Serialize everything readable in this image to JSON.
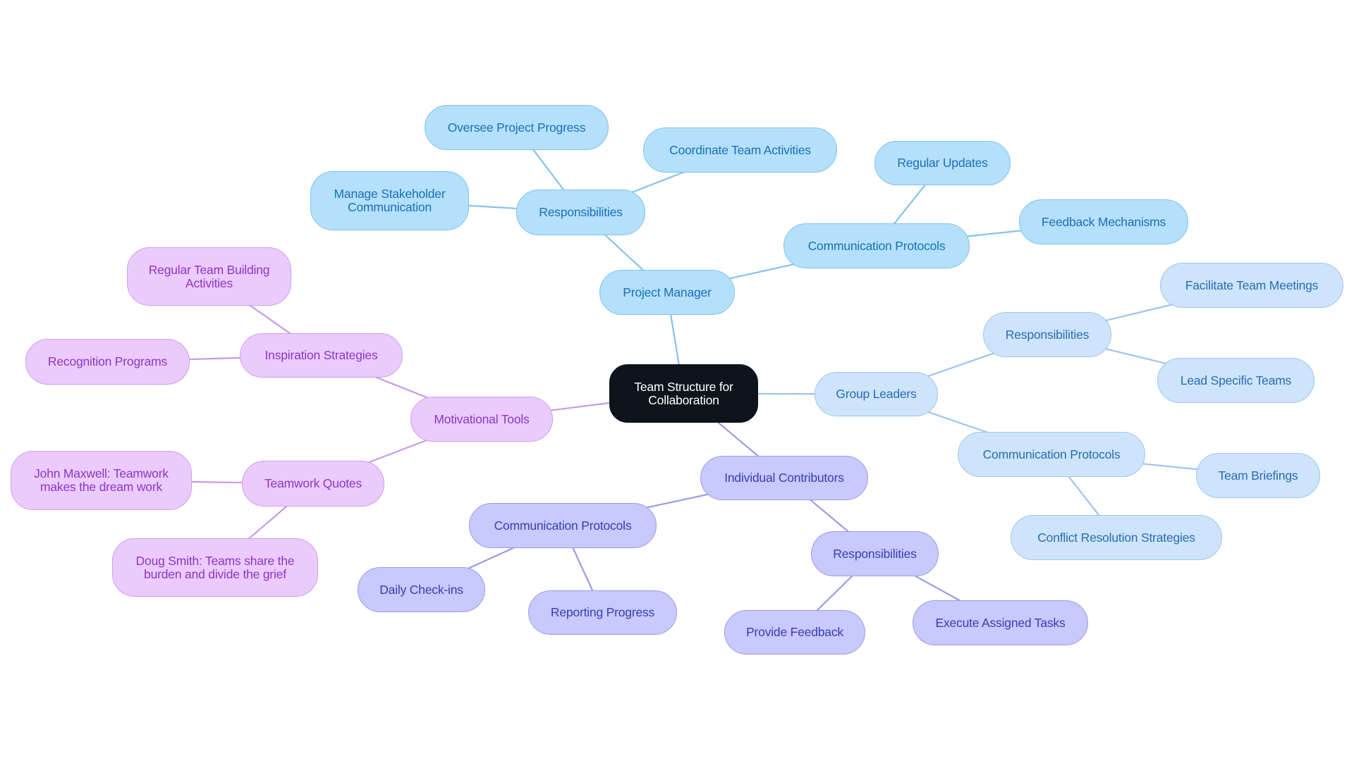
{
  "title": "Team Structure for Collaboration mind map",
  "themes": {
    "root": {
      "fill": "#0d141c",
      "border": "#0d141c",
      "text": "#ffffff",
      "line": "#82c3ec"
    },
    "project_manager": {
      "fill": "#b4e0fc",
      "border": "#80c3ec",
      "text": "#1a70b5",
      "line": "#82c3ec"
    },
    "group_leaders": {
      "fill": "#cde4fb",
      "border": "#9fc5ee",
      "text": "#2a6db2",
      "line": "#9fc4ec"
    },
    "individual_contributors": {
      "fill": "#c8c9fc",
      "border": "#9a9ce8",
      "text": "#3a3db4",
      "line": "#9a9ce2"
    },
    "motivational_tools": {
      "fill": "#ebcbfd",
      "border": "#caa0ea",
      "text": "#8c36c4",
      "line": "#c79ae6"
    }
  },
  "root": {
    "id": "root",
    "label": "Team Structure for\nCollaboration",
    "theme": "root"
  },
  "nodes": [
    {
      "id": "pm",
      "parent": "root",
      "label": "Project Manager",
      "theme": "project_manager"
    },
    {
      "id": "pm_resp",
      "parent": "pm",
      "label": "Responsibilities",
      "theme": "project_manager"
    },
    {
      "id": "pm_resp_oversee",
      "parent": "pm_resp",
      "label": "Oversee Project Progress",
      "theme": "project_manager"
    },
    {
      "id": "pm_resp_coord",
      "parent": "pm_resp",
      "label": "Coordinate Team Activities",
      "theme": "project_manager"
    },
    {
      "id": "pm_resp_manage",
      "parent": "pm_resp",
      "label": "Manage Stakeholder\nCommunication",
      "theme": "project_manager"
    },
    {
      "id": "pm_comm",
      "parent": "pm",
      "label": "Communication Protocols",
      "theme": "project_manager"
    },
    {
      "id": "pm_comm_updates",
      "parent": "pm_comm",
      "label": "Regular Updates",
      "theme": "project_manager"
    },
    {
      "id": "pm_comm_feedback",
      "parent": "pm_comm",
      "label": "Feedback Mechanisms",
      "theme": "project_manager"
    },
    {
      "id": "gl",
      "parent": "root",
      "label": "Group Leaders",
      "theme": "group_leaders"
    },
    {
      "id": "gl_resp",
      "parent": "gl",
      "label": "Responsibilities",
      "theme": "group_leaders"
    },
    {
      "id": "gl_resp_facilitate",
      "parent": "gl_resp",
      "label": "Facilitate Team Meetings",
      "theme": "group_leaders"
    },
    {
      "id": "gl_resp_lead",
      "parent": "gl_resp",
      "label": "Lead Specific Teams",
      "theme": "group_leaders"
    },
    {
      "id": "gl_comm",
      "parent": "gl",
      "label": "Communication Protocols",
      "theme": "group_leaders"
    },
    {
      "id": "gl_comm_briefings",
      "parent": "gl_comm",
      "label": "Team Briefings",
      "theme": "group_leaders"
    },
    {
      "id": "gl_comm_conflict",
      "parent": "gl_comm",
      "label": "Conflict Resolution Strategies",
      "theme": "group_leaders"
    },
    {
      "id": "ic",
      "parent": "root",
      "label": "Individual Contributors",
      "theme": "individual_contributors"
    },
    {
      "id": "ic_comm",
      "parent": "ic",
      "label": "Communication Protocols",
      "theme": "individual_contributors"
    },
    {
      "id": "ic_comm_daily",
      "parent": "ic_comm",
      "label": "Daily Check-ins",
      "theme": "individual_contributors"
    },
    {
      "id": "ic_comm_reporting",
      "parent": "ic_comm",
      "label": "Reporting Progress",
      "theme": "individual_contributors"
    },
    {
      "id": "ic_resp",
      "parent": "ic",
      "label": "Responsibilities",
      "theme": "individual_contributors"
    },
    {
      "id": "ic_resp_feedback",
      "parent": "ic_resp",
      "label": "Provide Feedback",
      "theme": "individual_contributors"
    },
    {
      "id": "ic_resp_execute",
      "parent": "ic_resp",
      "label": "Execute Assigned Tasks",
      "theme": "individual_contributors"
    },
    {
      "id": "mt",
      "parent": "root",
      "label": "Motivational Tools",
      "theme": "motivational_tools"
    },
    {
      "id": "mt_insp",
      "parent": "mt",
      "label": "Inspiration Strategies",
      "theme": "motivational_tools"
    },
    {
      "id": "mt_insp_building",
      "parent": "mt_insp",
      "label": "Regular Team Building\nActivities",
      "theme": "motivational_tools"
    },
    {
      "id": "mt_insp_recognition",
      "parent": "mt_insp",
      "label": "Recognition Programs",
      "theme": "motivational_tools"
    },
    {
      "id": "mt_quotes",
      "parent": "mt",
      "label": "Teamwork Quotes",
      "theme": "motivational_tools"
    },
    {
      "id": "mt_quotes_maxwell",
      "parent": "mt_quotes",
      "label": "John Maxwell: Teamwork\nmakes the dream work",
      "theme": "motivational_tools"
    },
    {
      "id": "mt_quotes_smith",
      "parent": "mt_quotes",
      "label": "Doug Smith: Teams share the\nburden and divide the grief",
      "theme": "motivational_tools"
    }
  ]
}
